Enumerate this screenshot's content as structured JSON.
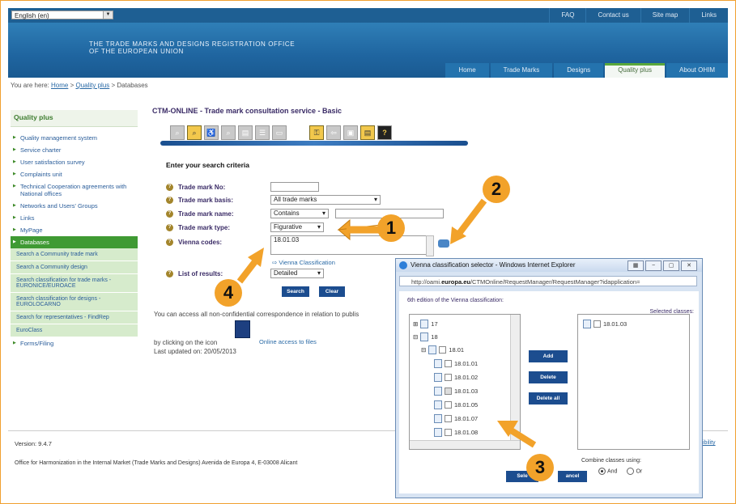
{
  "topbar": {
    "language": "English (en)",
    "links": [
      "FAQ",
      "Contact us",
      "Site map",
      "Links"
    ]
  },
  "banner": {
    "org_line1": "THE TRADE MARKS AND DESIGNS REGISTRATION OFFICE",
    "org_line2": "OF THE EUROPEAN UNION",
    "tabs": [
      "Home",
      "Trade Marks",
      "Designs",
      "Quality plus",
      "About OHIM"
    ],
    "active_tab": "Quality plus"
  },
  "breadcrumb": {
    "prefix": "You are here:",
    "home": "Home",
    "sep": ">",
    "quality": "Quality plus",
    "current": "Databases"
  },
  "sidebar": {
    "heading": "Quality plus",
    "items": [
      "Quality management system",
      "Service charter",
      "User satisfaction survey",
      "Complaints unit",
      "Technical Cooperation agreements with National offices",
      "Networks and Users' Groups",
      "Links",
      "MyPage",
      "Databases"
    ],
    "subitems": [
      "Search a Community trade mark",
      "Search a Community design",
      "Search classification for trade marks - EURONICE/EUROACE",
      "Search classification for designs - EUROLOCARNO",
      "Search for representatives - FindRep",
      "EuroClass"
    ],
    "last_item": "Forms/Filing"
  },
  "main": {
    "title": "CTM-ONLINE - Trade mark consultation service - Basic",
    "enter_heading": "Enter your search criteria",
    "labels": {
      "no": "Trade mark No:",
      "basis": "Trade mark basis:",
      "name": "Trade mark name:",
      "type": "Trade mark type:",
      "vienna": "Vienna codes:",
      "list": "List of results:"
    },
    "values": {
      "basis": "All trade marks",
      "name_op": "Contains",
      "type": "Figurative",
      "vienna": "18.01.03",
      "list": "Detailed"
    },
    "vienna_link": "Vienna Classification",
    "search_btn": "Search",
    "clear_btn": "Clear",
    "access_note": "You can access all non-confidential correspondence in relation to publis",
    "clicking": "by clicking on the icon",
    "online_files": "Online access to files",
    "updated": "Last updated on: 20/05/2013"
  },
  "footer": {
    "version": "Version: 9.4.7",
    "address": "Office for Harmonization in the Internal Market (Trade Marks and Designs) Avenida de Europa 4, E-03008 Alicant",
    "right": "ibility"
  },
  "popup": {
    "title": "Vienna classification selector - Windows Internet Explorer",
    "url_pre": "http://oami.",
    "url_bold": "europa.eu",
    "url_post": "/CTMOnline/RequestManager/RequestManager?idapplication=",
    "edition_label": "6th edition of the Vienna classification:",
    "selected_label": "Selected classes:",
    "tree": [
      "17",
      "18",
      "18.01",
      "18.01.01",
      "18.01.02",
      "18.01.03",
      "18.01.05",
      "18.01.07",
      "18.01.08"
    ],
    "selected": [
      "18.01.03"
    ],
    "add": "Add",
    "delete": "Delete",
    "delete_all": "Delete all",
    "combine": "Combine classes using:",
    "and": "And",
    "or": "Or",
    "select_btn": "Sele",
    "cancel_btn": "ancel"
  },
  "callouts": [
    "1",
    "2",
    "3",
    "4"
  ]
}
